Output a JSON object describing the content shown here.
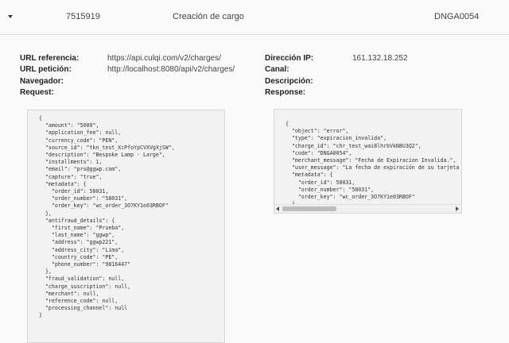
{
  "row": {
    "id": "7515919",
    "type": "Creación de cargo",
    "code": "DNGA0054"
  },
  "details": {
    "url_referencia_label": "URL referencia:",
    "url_referencia_value": "https://api.culqi.com/v2/charges/",
    "url_peticion_label": "URL petición:",
    "url_peticion_value": "http://localhost:8080/api/v2/charges/",
    "navegador_label": "Navegador:",
    "request_label": "Request:",
    "direccion_ip_label": "Dirección IP:",
    "direccion_ip_value": "161.132.18.252",
    "canal_label": "Canal:",
    "descripcion_label": "Descripción:",
    "response_label": "Response:"
  },
  "request_json": "{\n  \"amount\": \"5000\",\n  \"application_fee\": null,\n  \"currency_code\": \"PEN\",\n  \"source_id\": \"tkn_test_XcPfoYpCVXVgXjSW\",\n  \"description\": \"Bespoke Lamp - Large\",\n  \"installments\": 1,\n  \"email\": \"prs@ggwp.com\",\n  \"capture\": \"true\",\n  \"metadata\": {\n    \"order_id\": 58031,\n    \"order_number\": \"58031\",\n    \"order_key\": \"wc_order_3O7KY1e03RBOF\"\n  },\n  \"antifraud_details\": {\n    \"first_name\": \"Prueba\",\n    \"last_name\": \"ggwp\",\n    \"address\": \"ggwp221\",\n    \"address_city\": \"Lima\",\n    \"country_code\": \"PE\",\n    \"phone_number\": \"9816447\"\n  },\n  \"fraud_validation\": null,\n  \"charge_suscription\": null,\n  \"merchant\": null,\n  \"reference_code\": null,\n  \"processing_channel\": null\n}",
  "response_json": "{\n  \"object\": \"error\",\n  \"type\": \"expiracion_invalida\",\n  \"charge_id\": \"chr_test_wai8lhrbVkN8U3Q2\",\n  \"code\": \"DNGA0054\",\n  \"merchant_message\": \"Fecha de Expiracion Invalida.\",\n  \"user_message\": \"La fecha de expiración de su tarjeta\n  \"metadata\": {\n    \"order_id\": 58031,\n    \"order_number\": \"58031\",\n    \"order_key\": \"wc_order_3O7KY1e03RBOF\"\n  }\n}"
}
